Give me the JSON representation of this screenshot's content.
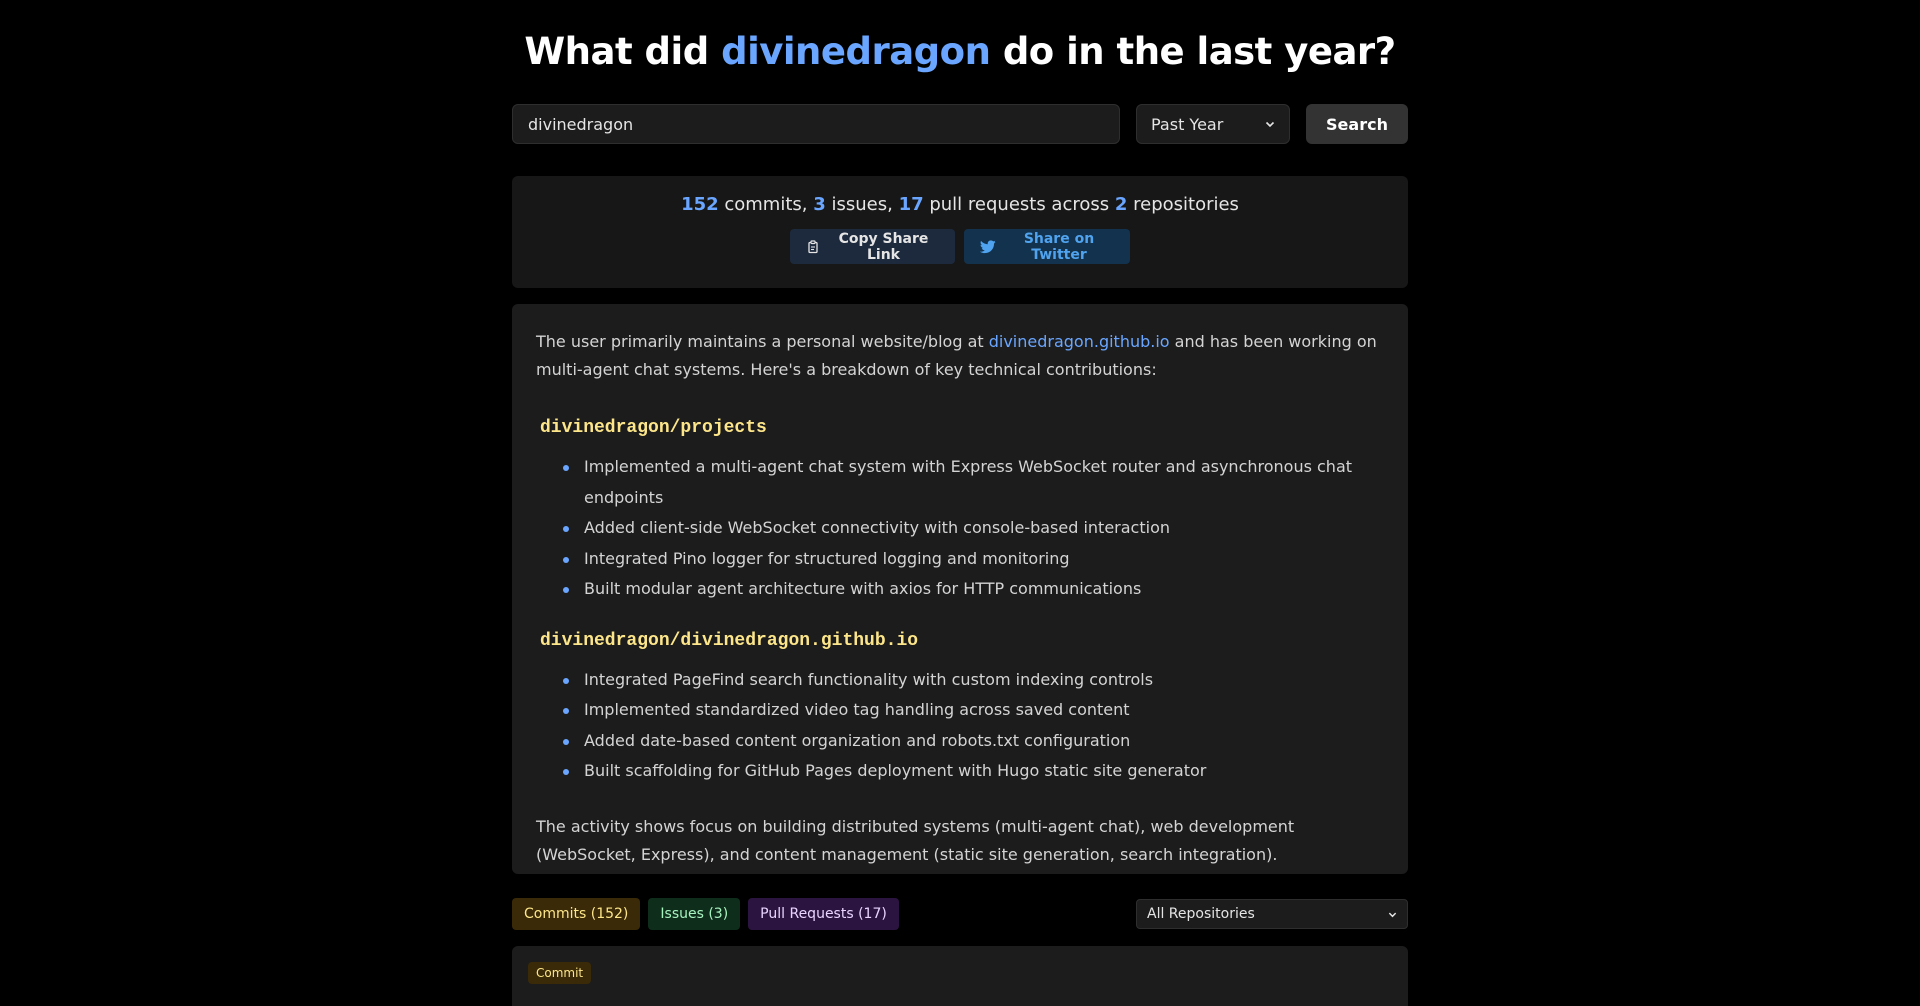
{
  "header": {
    "title_prefix": "What did ",
    "username": "divinedragon",
    "title_suffix": " do in the last year?"
  },
  "search": {
    "input_value": "divinedragon",
    "period_selected": "Past Year",
    "button_label": "Search"
  },
  "stats": {
    "commits": "152",
    "commits_label": " commits, ",
    "issues": "3",
    "issues_label": " issues, ",
    "pull_requests": "17",
    "pull_requests_label": " pull requests across ",
    "repositories": "2",
    "repositories_label": " repositories",
    "copy_label": "Copy Share Link",
    "twitter_label": "Share on Twitter"
  },
  "summary": {
    "intro_before": "The user primarily maintains a personal website/blog at ",
    "intro_link": "divinedragon.github.io",
    "intro_after": " and has been working on multi-agent chat systems. Here's a breakdown of key technical contributions:",
    "repos": [
      {
        "name": "divinedragon/projects",
        "items": [
          "Implemented a multi-agent chat system with Express WebSocket router and asynchronous chat endpoints",
          "Added client-side WebSocket connectivity with console-based interaction",
          "Integrated Pino logger for structured logging and monitoring",
          "Built modular agent architecture with axios for HTTP communications"
        ]
      },
      {
        "name": "divinedragon/divinedragon.github.io",
        "items": [
          "Integrated PageFind search functionality with custom indexing controls",
          "Implemented standardized video tag handling across saved content",
          "Added date-based content organization and robots.txt configuration",
          "Built scaffolding for GitHub Pages deployment with Hugo static site generator"
        ]
      }
    ],
    "closing": "The activity shows focus on building distributed systems (multi-agent chat), web development (WebSocket, Express), and content management (static site generation, search integration)."
  },
  "tabs": {
    "commits": "Commits (152)",
    "issues": "Issues (3)",
    "pull_requests": "Pull Requests (17)",
    "repo_filter": "All Repositories"
  },
  "events": [
    {
      "badge": "Commit"
    }
  ],
  "icons": {
    "copy": "clipboard-icon",
    "twitter": "twitter-bird-icon",
    "select": "chevron-down-icon"
  },
  "colors": {
    "accent": "#6aa6ff",
    "repo_title": "#fde68a",
    "twitter": "#4fa3ef"
  }
}
